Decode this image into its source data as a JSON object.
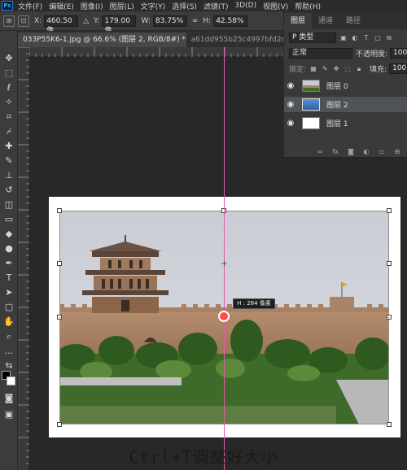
{
  "app": {
    "logo_text": "Ps"
  },
  "menu": [
    "文件(F)",
    "编辑(E)",
    "图像(I)",
    "图层(L)",
    "文字(Y)",
    "选择(S)",
    "滤镜(T)",
    "3D(D)",
    "视图(V)",
    "帮助(H)"
  ],
  "options": {
    "x_label": "X:",
    "x_value": "460.50 像",
    "y_label": "Y:",
    "y_value": "179.00 像",
    "w_label": "W:",
    "w_value": "83.75%",
    "h_label": "H:",
    "h_value": "42.58%"
  },
  "tabs": [
    {
      "label": "033P55K6-1.jpg @ 66.6% (图层 2, RGB/8#) *",
      "close": "×",
      "active": true
    },
    {
      "label": "a61dd955b25c4997bfd2c9",
      "active": false
    }
  ],
  "layers_panel": {
    "tabs": [
      "图层",
      "通道",
      "路径"
    ],
    "search_placeholder": "P 类型",
    "blend_mode": "正常",
    "opacity_label": "不透明度:",
    "opacity_value": "100",
    "lock_label": "锁定:",
    "fill_label": "填充:",
    "fill_value": "100",
    "layers": [
      {
        "name": "图层 0",
        "visible": true,
        "selected": false
      },
      {
        "name": "图层 2",
        "visible": true,
        "selected": true
      },
      {
        "name": "图层 1",
        "visible": true,
        "selected": false
      }
    ]
  },
  "canvas": {
    "size_tooltip": "H : 284 像素"
  },
  "caption": "Ctrl+T调整好大小",
  "colors": {
    "guide": "#e55aa8",
    "selected_layer": "#4f5257",
    "workspace": "#282828"
  }
}
